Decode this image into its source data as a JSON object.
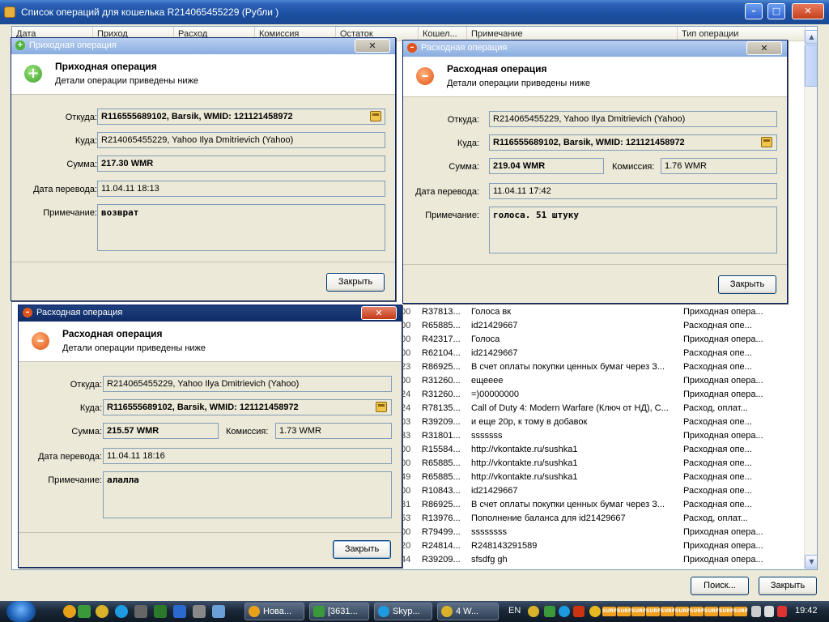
{
  "main_window": {
    "title": "Список операций для кошелька R214065455229 (Рубли )",
    "minimize": "–",
    "maximize": "□",
    "close": "✕"
  },
  "grid": {
    "columns": [
      "Дата",
      "Приход",
      "Расход",
      "Комиссия",
      "Остаток",
      "Кошел...",
      "Примечание",
      "Тип операции"
    ],
    "rows": [
      {
        "amount": "00",
        "wallet": "R37813...",
        "note": "Голоса вк",
        "type": "Приходная опера..."
      },
      {
        "amount": "00",
        "wallet": "R65885...",
        "note": "id21429667",
        "type": "Расходная опе..."
      },
      {
        "amount": "00",
        "wallet": "R42317...",
        "note": "Голоса",
        "type": "Приходная опера..."
      },
      {
        "amount": "00",
        "wallet": "R62104...",
        "note": "id21429667",
        "type": "Расходная опе..."
      },
      {
        "amount": "23",
        "wallet": "R86925...",
        "note": "В счет оплаты покупки ценных бумаг через З...",
        "type": "Расходная опе..."
      },
      {
        "amount": "00",
        "wallet": "R31260...",
        "note": "ещееее",
        "type": "Приходная опера..."
      },
      {
        "amount": "24",
        "wallet": "R31260...",
        "note": "=)00000000",
        "type": "Приходная опера..."
      },
      {
        "amount": "24",
        "wallet": "R78135...",
        "note": "Call of Duty 4: Modern Warfare (Ключ от НД), С...",
        "type": "Расход, оплат..."
      },
      {
        "amount": "03",
        "wallet": "R39209...",
        "note": "и еще 20р, к тому в добавок",
        "type": "Расходная опе..."
      },
      {
        "amount": "33",
        "wallet": "R31801...",
        "note": "sssssss",
        "type": "Приходная опера..."
      },
      {
        "amount": "00",
        "wallet": "R15584...",
        "note": "http://vkontakte.ru/sushka1",
        "type": "Расходная опе..."
      },
      {
        "amount": "00",
        "wallet": "R65885...",
        "note": "http://vkontakte.ru/sushka1",
        "type": "Расходная опе..."
      },
      {
        "amount": "49",
        "wallet": "R65885...",
        "note": "http://vkontakte.ru/sushka1",
        "type": "Расходная опе..."
      },
      {
        "amount": "00",
        "wallet": "R10843...",
        "note": "id21429667",
        "type": "Расходная опе..."
      },
      {
        "amount": "81",
        "wallet": "R86925...",
        "note": "В счет оплаты покупки ценных бумаг через З...",
        "type": "Расходная опе..."
      },
      {
        "amount": "53",
        "wallet": "R13976...",
        "note": "Пополнение баланса для id21429667",
        "type": "Расход, оплат..."
      },
      {
        "amount": "00",
        "wallet": "R79499...",
        "note": "ssssssss",
        "type": "Приходная опера..."
      },
      {
        "amount": "20",
        "wallet": "R24814...",
        "note": "R248143291589",
        "type": "Приходная опера..."
      },
      {
        "amount": "44",
        "wallet": "R39209...",
        "note": "sfsdfg gh",
        "type": "Приходная опера..."
      }
    ]
  },
  "footer": {
    "search_label": "Поиск...",
    "close_label": "Закрыть"
  },
  "dialogs": {
    "income": {
      "title": "Приходная операция",
      "heading": "Приходная операция",
      "subheading": "Детали операции приведены ниже",
      "from_label": "Откуда:",
      "from": "R116555689102, Barsik, WMID: 121121458972",
      "to_label": "Куда:",
      "to": "R214065455229, Yahoo Ilya Dmitrievich (Yahoo)",
      "sum_label": "Сумма:",
      "sum": "217.30 WMR",
      "date_label": "Дата перевода:",
      "date": "11.04.11 18:13",
      "note_label": "Примечание:",
      "note": "возврат",
      "close_label": "Закрыть"
    },
    "expense1": {
      "title": "Расходная операция",
      "heading": "Расходная операция",
      "subheading": "Детали операции приведены ниже",
      "from_label": "Откуда:",
      "from": "R214065455229, Yahoo Ilya Dmitrievich (Yahoo)",
      "to_label": "Куда:",
      "to": "R116555689102, Barsik, WMID: 121121458972",
      "sum_label": "Сумма:",
      "sum": "219.04 WMR",
      "fee_label": "Комиссия:",
      "fee": "1.76 WMR",
      "date_label": "Дата перевода:",
      "date": "11.04.11 17:42",
      "note_label": "Примечание:",
      "note": "голоса. 51 штуку",
      "close_label": "Закрыть"
    },
    "expense2": {
      "title": "Расходная операция",
      "heading": "Расходная операция",
      "subheading": "Детали операции приведены ниже",
      "from_label": "Откуда:",
      "from": "R214065455229, Yahoo Ilya Dmitrievich (Yahoo)",
      "to_label": "Куда:",
      "to": "R116555689102, Barsik, WMID: 121121458972",
      "sum_label": "Сумма:",
      "sum": "215.57 WMR",
      "fee_label": "Комиссия:",
      "fee": "1.73 WMR",
      "date_label": "Дата перевода:",
      "date": "11.04.11 18:16",
      "note_label": "Примечание:",
      "note": "алалла",
      "close_label": "Закрыть"
    }
  },
  "taskbar": {
    "tasks": [
      "Нова...",
      "[3631...",
      "Skyp...",
      "4 W..."
    ],
    "language": "EN",
    "surf_label": "SURF",
    "clock": "19:42"
  },
  "colors": {
    "titlebar": "#1b4ea0",
    "dialog_bg": "#ece9d8",
    "income_icon": "#3aa12a",
    "expense_icon": "#e05414"
  }
}
